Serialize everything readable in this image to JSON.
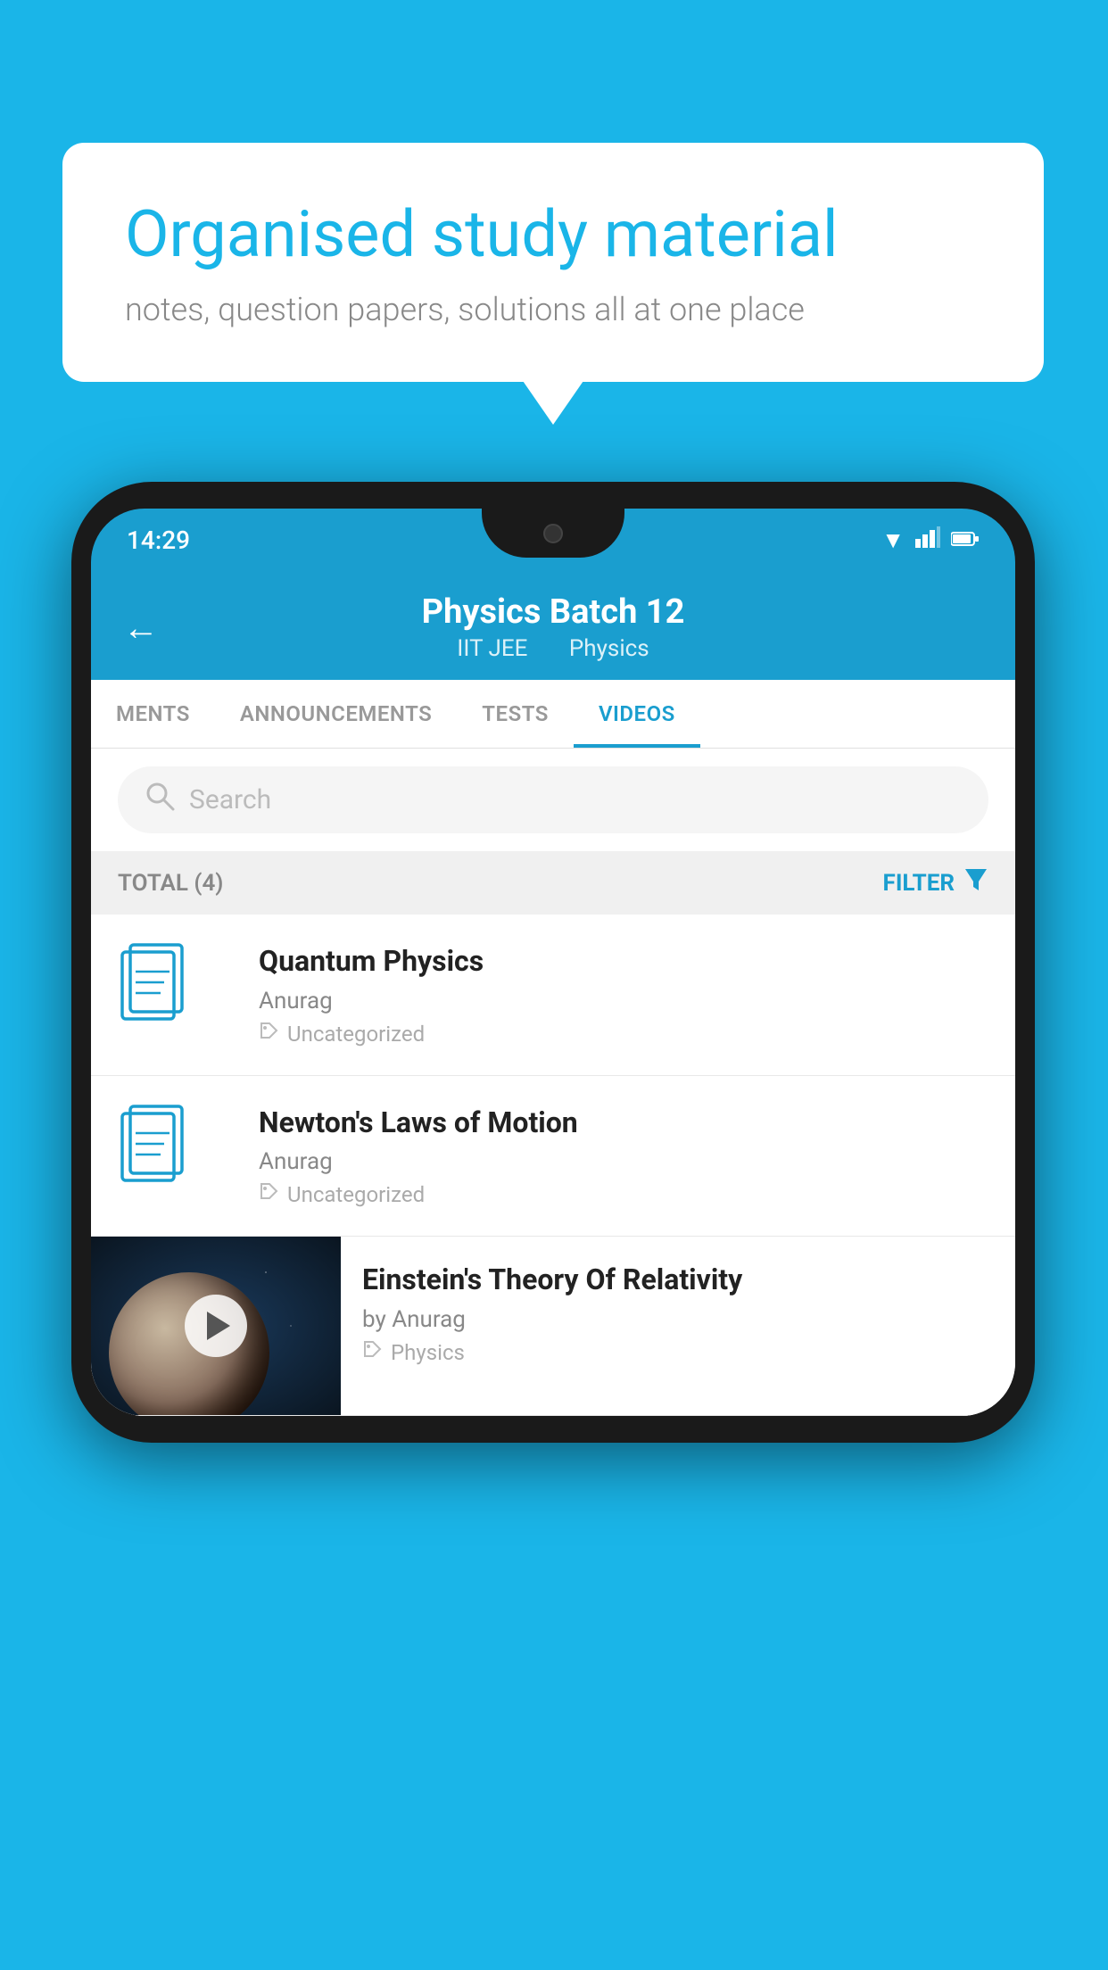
{
  "background": {
    "color": "#1ab5e8"
  },
  "speech_bubble": {
    "title": "Organised study material",
    "subtitle": "notes, question papers, solutions all at one place"
  },
  "status_bar": {
    "time": "14:29",
    "wifi": "▾",
    "signal": "▴",
    "battery": "▮"
  },
  "header": {
    "title": "Physics Batch 12",
    "subtitle1": "IIT JEE",
    "subtitle2": "Physics",
    "back_label": "←"
  },
  "tabs": [
    {
      "label": "MENTS",
      "active": false
    },
    {
      "label": "ANNOUNCEMENTS",
      "active": false
    },
    {
      "label": "TESTS",
      "active": false
    },
    {
      "label": "VIDEOS",
      "active": true
    }
  ],
  "search": {
    "placeholder": "Search"
  },
  "filter": {
    "total_label": "TOTAL (4)",
    "filter_label": "FILTER"
  },
  "videos": [
    {
      "id": 0,
      "title": "Quantum Physics",
      "author": "Anurag",
      "tag": "Uncategorized",
      "has_thumbnail": false
    },
    {
      "id": 1,
      "title": "Newton's Laws of Motion",
      "author": "Anurag",
      "tag": "Uncategorized",
      "has_thumbnail": false
    },
    {
      "id": 2,
      "title": "Einstein's Theory Of Relativity",
      "author": "by Anurag",
      "tag": "Physics",
      "has_thumbnail": true
    }
  ]
}
